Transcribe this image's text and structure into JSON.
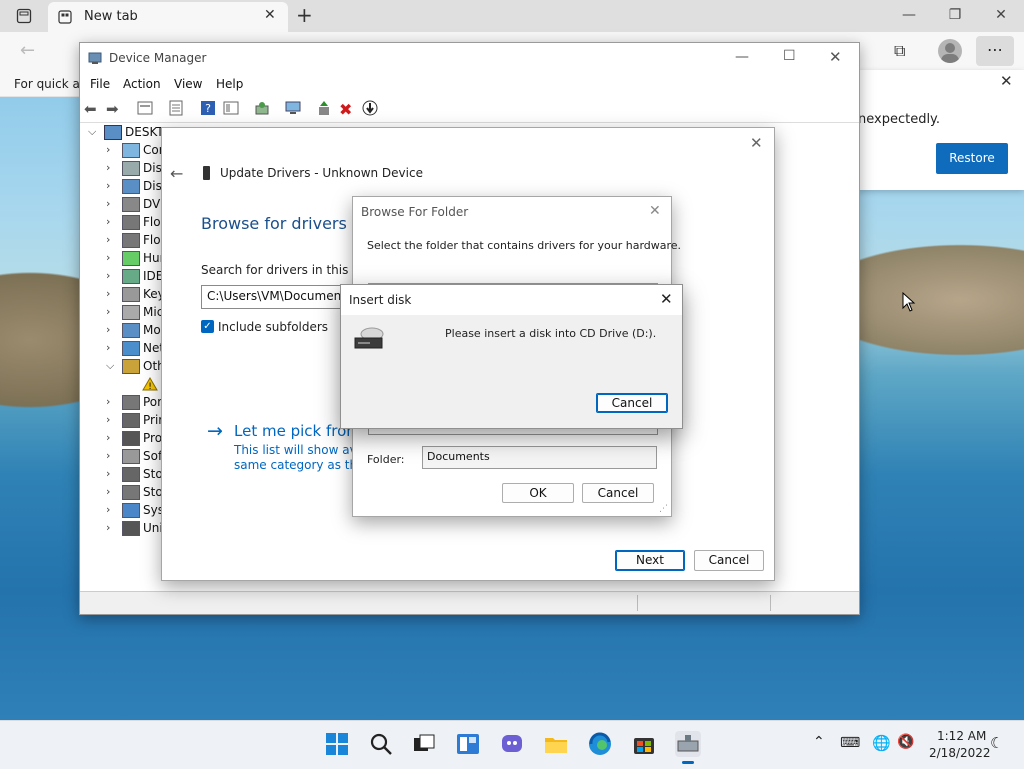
{
  "browser": {
    "tab_title": "New tab",
    "favbar_text": "For quick ac",
    "crash_message": "nexpectedly.",
    "restore_button": "Restore"
  },
  "device_manager": {
    "title": "Device Manager",
    "menu": [
      "File",
      "Action",
      "View",
      "Help"
    ],
    "tree_root": "DESKTO",
    "tree_items": [
      "Cor",
      "Disk",
      "Disp",
      "DVD",
      "Flop",
      "Flop",
      "Hun",
      "IDE",
      "Key",
      "Mic",
      "Mo",
      "Net",
      "Oth",
      "",
      "Por",
      "Prir",
      "Pro",
      "Soft",
      "Stor",
      "Stor",
      "Syst",
      "Uni"
    ]
  },
  "update_drivers": {
    "title": "Update Drivers - Unknown Device",
    "heading": "Browse for drivers on",
    "search_label": "Search for drivers in this locat",
    "path_value": "C:\\Users\\VM\\Documents",
    "include_subfolders": "Include subfolders",
    "pick_link": "Let me pick from",
    "pick_desc_1": "This list will show avail",
    "pick_desc_2": "same category as the d",
    "next": "Next",
    "cancel": "Cancel"
  },
  "browse_folder": {
    "title": "Browse For Folder",
    "instruction": "Select the folder that contains drivers for your hardware.",
    "folder_label": "Folder:",
    "folder_value": "Documents",
    "ok": "OK",
    "cancel": "Cancel"
  },
  "insert_disk": {
    "title": "Insert disk",
    "message": "Please insert a disk into CD Drive (D:).",
    "cancel": "Cancel"
  },
  "taskbar": {
    "time": "1:12 AM",
    "date": "2/18/2022"
  },
  "colors": {
    "accent": "#0067c0",
    "link": "#0067c0"
  }
}
